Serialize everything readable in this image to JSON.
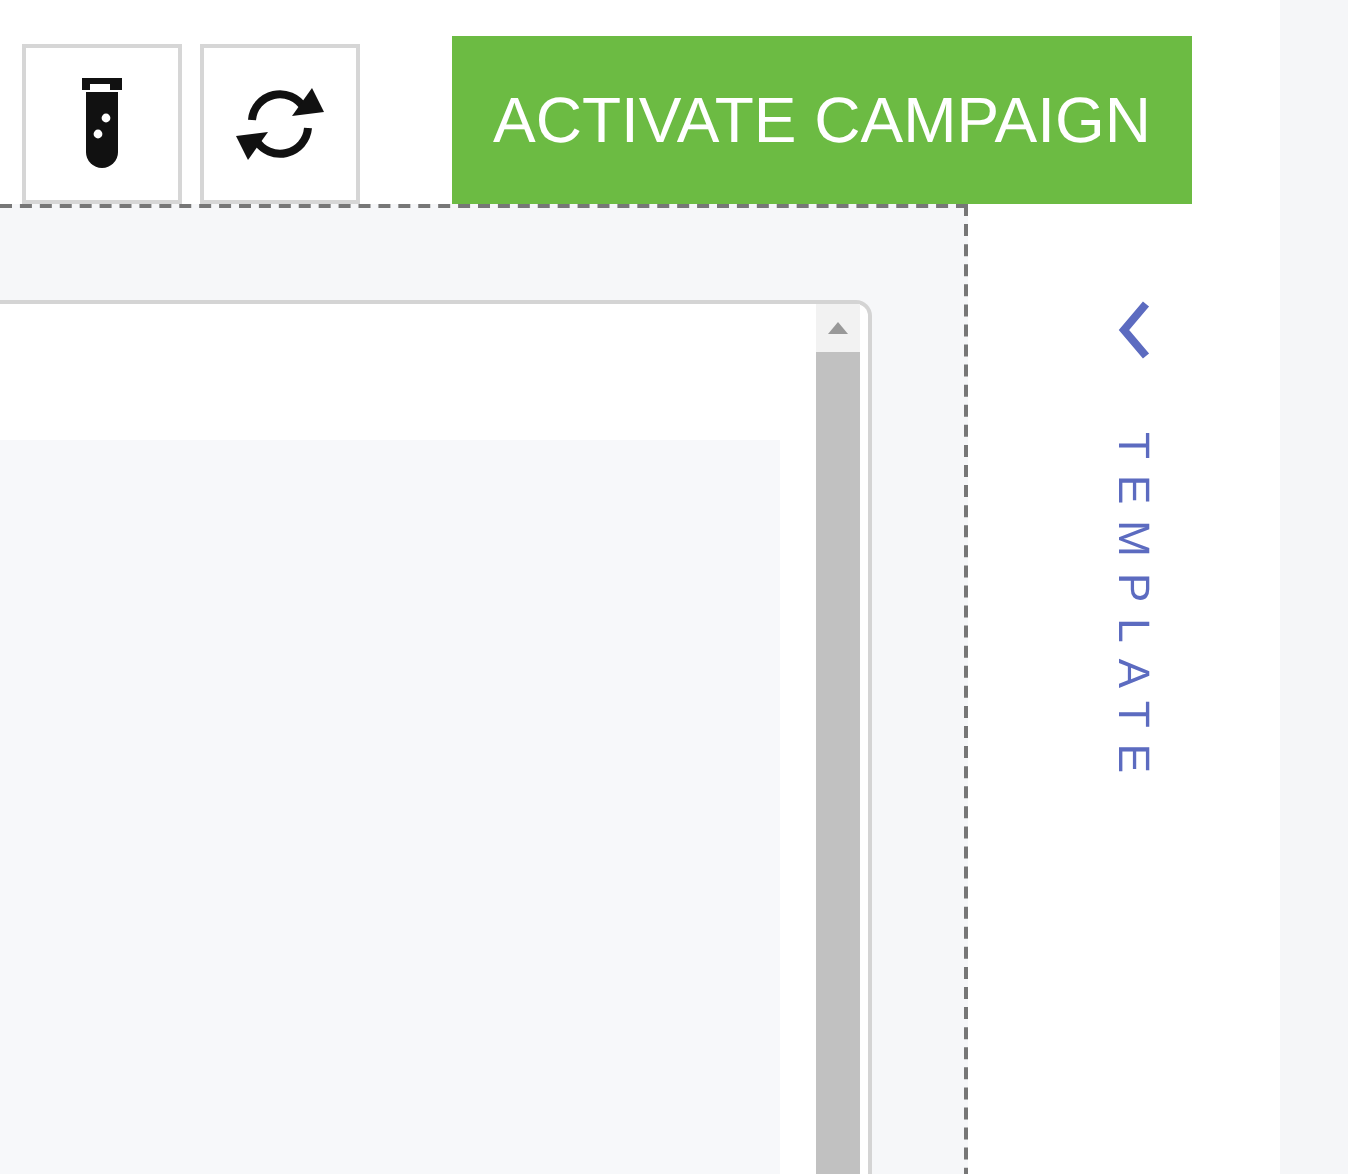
{
  "toolbar": {
    "primary_button": "ACTIVATE CAMPAIGN"
  },
  "side_panel": {
    "label": "TEMPLATE"
  }
}
